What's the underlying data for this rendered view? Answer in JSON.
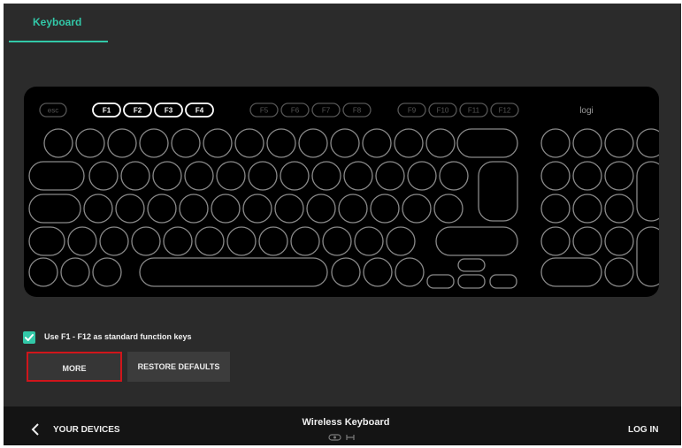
{
  "tabs": [
    {
      "label": "Keyboard",
      "active": true
    }
  ],
  "keyboard": {
    "brand": "logi",
    "esc_label": "esc",
    "fkeys": [
      {
        "label": "F1",
        "highlighted": true
      },
      {
        "label": "F2",
        "highlighted": true
      },
      {
        "label": "F3",
        "highlighted": true
      },
      {
        "label": "F4",
        "highlighted": true
      },
      {
        "label": "F5",
        "highlighted": false
      },
      {
        "label": "F6",
        "highlighted": false
      },
      {
        "label": "F7",
        "highlighted": false
      },
      {
        "label": "F8",
        "highlighted": false
      },
      {
        "label": "F9",
        "highlighted": false
      },
      {
        "label": "F10",
        "highlighted": false
      },
      {
        "label": "F11",
        "highlighted": false
      },
      {
        "label": "F12",
        "highlighted": false
      }
    ]
  },
  "settings": {
    "fn_keys": {
      "label": "Use F1 - F12 as standard function keys",
      "checked": true
    }
  },
  "buttons": {
    "more": "MORE",
    "restore": "RESTORE DEFAULTS"
  },
  "footer": {
    "back_label": "YOUR DEVICES",
    "device_name": "Wireless Keyboard",
    "login": "LOG IN"
  },
  "colors": {
    "accent": "#32c8a8",
    "highlight_border": "#d0151b",
    "key_outline": "#8a8a8a",
    "fkey_active": "#ffffff",
    "fkey_inactive": "#555555"
  },
  "icons": {
    "back": "chevron-left-icon",
    "checkbox": "checkmark-icon",
    "connection": "unifying-receiver-icon",
    "bluetooth": "bluetooth-icon"
  }
}
